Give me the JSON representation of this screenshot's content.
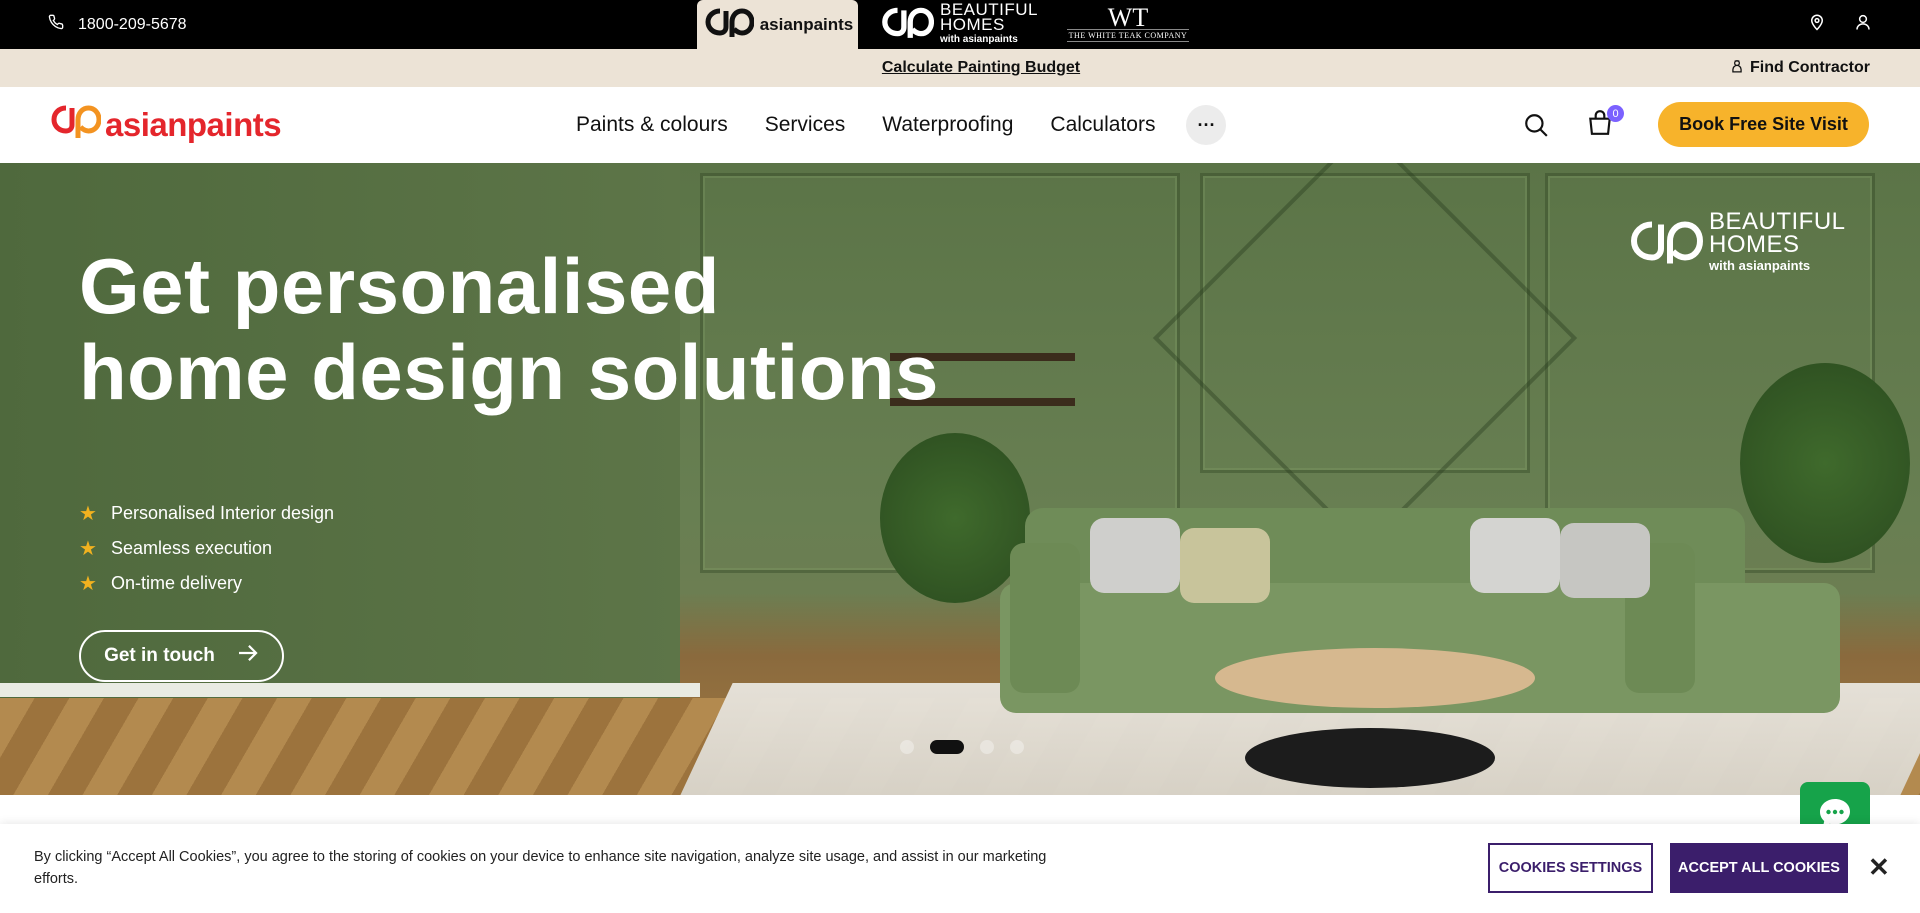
{
  "topbar": {
    "phone": "1800-209-5678",
    "brands": [
      {
        "name": "asianpaints"
      },
      {
        "name": "BEAUTIFUL",
        "line2": "HOMES",
        "sub": "with asianpaints"
      },
      {
        "mono": "WT",
        "name": "THE WHITE TEAK COMPANY"
      }
    ]
  },
  "subbar": {
    "budget_link": "Calculate Painting Budget",
    "find_contractor": "Find Contractor"
  },
  "nav": {
    "logo_text": "asianpaints",
    "menu": [
      "Paints & colours",
      "Services",
      "Waterproofing",
      "Calculators"
    ],
    "more": "···",
    "cart_count": "0",
    "book_button": "Book Free Site Visit"
  },
  "hero": {
    "title_line1": "Get personalised",
    "title_line2": "home design solutions",
    "features": [
      "Personalised Interior design",
      "Seamless execution",
      "On-time delivery"
    ],
    "cta": "Get in touch",
    "watermark": {
      "line1": "BEAUTIFUL",
      "line2": "HOMES",
      "sub": "with asianpaints"
    },
    "slides_total": 4,
    "active_slide": 2
  },
  "cookie": {
    "text": "By clicking “Accept All Cookies”, you agree to the storing of cookies on your device to enhance site navigation, analyze site usage, and assist in our marketing efforts.",
    "settings_label": "COOKIES SETTINGS",
    "accept_label": "ACCEPT ALL COOKIES",
    "close": "✕"
  },
  "colors": {
    "accent_button": "#f7b32b",
    "cookie_primary": "#3b1e6b",
    "brand_red": "#e4262c",
    "topbar_bg": "#000000",
    "subbar_bg": "#ece3d6",
    "cart_badge": "#7b61ff",
    "chat": "#16a34a"
  },
  "icons": [
    "phone-icon",
    "location-pin-icon",
    "user-icon",
    "contractor-icon",
    "search-icon",
    "cart-icon",
    "star-icon",
    "arrow-right-icon",
    "chat-icon",
    "close-icon"
  ]
}
